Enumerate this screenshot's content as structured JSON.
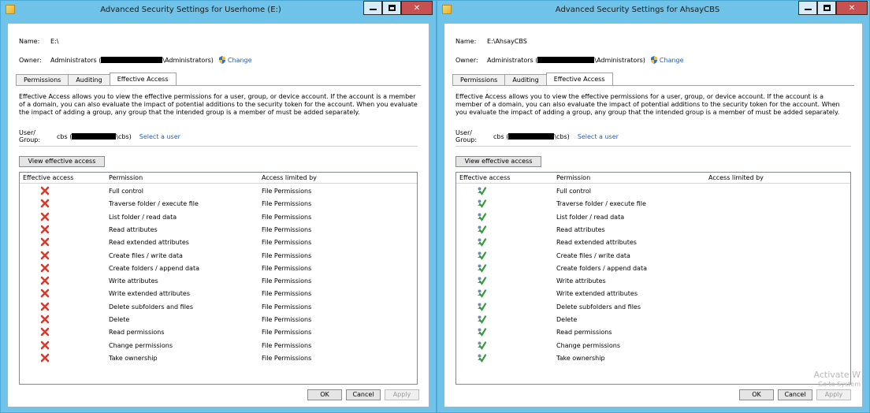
{
  "windows": [
    {
      "title": "Advanced Security Settings for Userhome (E:)",
      "name_label": "Name:",
      "name_value": "E:\\",
      "owner_label": "Owner:",
      "owner_prefix": "Administrators (",
      "owner_suffix": "\\Administrators)",
      "change_link": "Change",
      "tabs": [
        "Permissions",
        "Auditing",
        "Effective Access"
      ],
      "active_tab": "Effective Access",
      "description": "Effective Access allows you to view the effective permissions for a user, group, or device account. If the account is a member of a domain, you can also evaluate the impact of potential additions to the security token for the account. When you evaluate the impact of adding a group, any group that the intended group is a member of must be added separately.",
      "user_group_label": "User/ Group:",
      "user_prefix": "cbs (",
      "user_suffix": "\\cbs)",
      "select_user_link": "Select a user",
      "view_button": "View effective access",
      "columns": [
        "Effective access",
        "Permission",
        "Access limited by"
      ],
      "access_icon": "red-x-icon",
      "rows": [
        {
          "permission": "Full control",
          "limited_by": "File Permissions"
        },
        {
          "permission": "Traverse folder / execute file",
          "limited_by": "File Permissions"
        },
        {
          "permission": "List folder / read data",
          "limited_by": "File Permissions"
        },
        {
          "permission": "Read attributes",
          "limited_by": "File Permissions"
        },
        {
          "permission": "Read extended attributes",
          "limited_by": "File Permissions"
        },
        {
          "permission": "Create files / write data",
          "limited_by": "File Permissions"
        },
        {
          "permission": "Create folders / append data",
          "limited_by": "File Permissions"
        },
        {
          "permission": "Write attributes",
          "limited_by": "File Permissions"
        },
        {
          "permission": "Write extended attributes",
          "limited_by": "File Permissions"
        },
        {
          "permission": "Delete subfolders and files",
          "limited_by": "File Permissions"
        },
        {
          "permission": "Delete",
          "limited_by": "File Permissions"
        },
        {
          "permission": "Read permissions",
          "limited_by": "File Permissions"
        },
        {
          "permission": "Change permissions",
          "limited_by": "File Permissions"
        },
        {
          "permission": "Take ownership",
          "limited_by": "File Permissions"
        }
      ],
      "ok": "OK",
      "cancel": "Cancel",
      "apply": "Apply"
    },
    {
      "title": "Advanced Security Settings for AhsayCBS",
      "name_label": "Name:",
      "name_value": "E:\\AhsayCBS",
      "owner_label": "Owner:",
      "owner_prefix": "Administrators (",
      "owner_suffix": "\\Administrators)",
      "change_link": "Change",
      "tabs": [
        "Permissions",
        "Auditing",
        "Effective Access"
      ],
      "active_tab": "Effective Access",
      "description": "Effective Access allows you to view the effective permissions for a user, group, or device account. If the account is a member of a domain, you can also evaluate the impact of potential additions to the security token for the account. When you evaluate the impact of adding a group, any group that the intended group is a member of must be added separately.",
      "user_group_label": "User/ Group:",
      "user_prefix": "cbs (",
      "user_suffix": "\\cbs)",
      "select_user_link": "Select a user",
      "view_button": "View effective access",
      "columns": [
        "Effective access",
        "Permission",
        "Access limited by"
      ],
      "access_icon": "green-check-user-icon",
      "rows": [
        {
          "permission": "Full control",
          "limited_by": ""
        },
        {
          "permission": "Traverse folder / execute file",
          "limited_by": ""
        },
        {
          "permission": "List folder / read data",
          "limited_by": ""
        },
        {
          "permission": "Read attributes",
          "limited_by": ""
        },
        {
          "permission": "Read extended attributes",
          "limited_by": ""
        },
        {
          "permission": "Create files / write data",
          "limited_by": ""
        },
        {
          "permission": "Create folders / append data",
          "limited_by": ""
        },
        {
          "permission": "Write attributes",
          "limited_by": ""
        },
        {
          "permission": "Write extended attributes",
          "limited_by": ""
        },
        {
          "permission": "Delete subfolders and files",
          "limited_by": ""
        },
        {
          "permission": "Delete",
          "limited_by": ""
        },
        {
          "permission": "Read permissions",
          "limited_by": ""
        },
        {
          "permission": "Change permissions",
          "limited_by": ""
        },
        {
          "permission": "Take ownership",
          "limited_by": ""
        }
      ],
      "ok": "OK",
      "cancel": "Cancel",
      "apply": "Apply",
      "watermark_line1": "Activate W",
      "watermark_line2": "Go to System"
    }
  ],
  "colors": {
    "window_frame": "#6fc3e8",
    "link": "#1f5fbf",
    "deny": "#d93a2b",
    "allow": "#3b9a3b",
    "close_button": "#c75050"
  }
}
